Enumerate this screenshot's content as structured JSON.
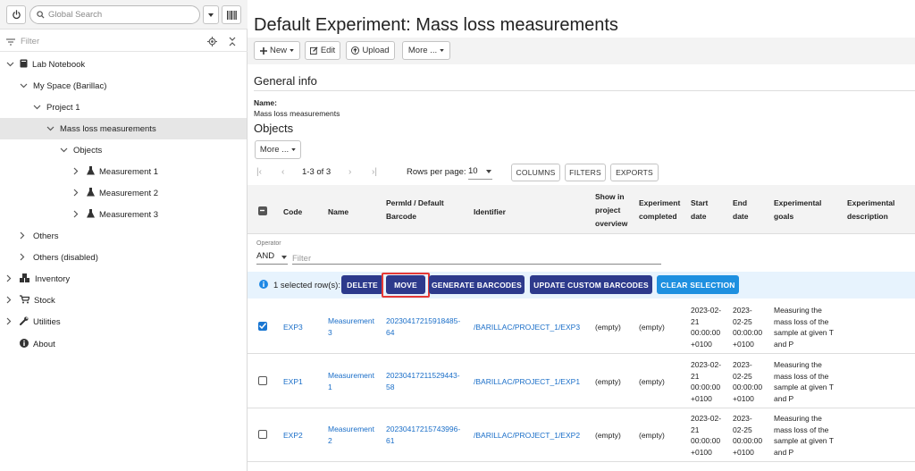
{
  "sidebar": {
    "search_placeholder": "Global Search",
    "filter_placeholder": "Filter",
    "tree": [
      {
        "label": "Lab Notebook",
        "icon": "book-icon",
        "chev": "down"
      },
      {
        "label": "My Space (Barillac)",
        "icon": "",
        "chev": "down"
      },
      {
        "label": "Project 1",
        "icon": "",
        "chev": "down"
      },
      {
        "label": "Mass loss measurements",
        "icon": "",
        "chev": "down"
      },
      {
        "label": "Objects",
        "icon": "",
        "chev": "down"
      },
      {
        "label": "Measurement 1",
        "icon": "flask-icon",
        "chev": "right"
      },
      {
        "label": "Measurement 2",
        "icon": "flask-icon",
        "chev": "right"
      },
      {
        "label": "Measurement 3",
        "icon": "flask-icon",
        "chev": "right"
      },
      {
        "label": "Others",
        "icon": "",
        "chev": "right"
      },
      {
        "label": "Others (disabled)",
        "icon": "",
        "chev": "right"
      },
      {
        "label": "Inventory",
        "icon": "boxes-icon",
        "chev": "right"
      },
      {
        "label": "Stock",
        "icon": "cart-icon",
        "chev": "right"
      },
      {
        "label": "Utilities",
        "icon": "wrench-icon",
        "chev": "right"
      },
      {
        "label": "About",
        "icon": "info-icon",
        "chev": ""
      }
    ]
  },
  "main": {
    "title": "Default Experiment: Mass loss measurements",
    "toolbar": {
      "new": "New",
      "edit": "Edit",
      "upload": "Upload",
      "more": "More ..."
    },
    "general_info": "General info",
    "name_label": "Name:",
    "name_value": "Mass loss measurements",
    "objects_heading": "Objects",
    "objects_more": "More ...",
    "pagination": {
      "range": "1-3 of 3",
      "rows_per_page_label": "Rows per page:",
      "rows_per_page": "10"
    },
    "table_buttons": {
      "columns": "COLUMNS",
      "filters": "FILTERS",
      "exports": "EXPORTS"
    },
    "headers": {
      "code": "Code",
      "name": "Name",
      "permid": [
        "PermId / Default",
        "Barcode"
      ],
      "identifier": "Identifier",
      "show_in_project": [
        "Show in",
        "project",
        "overview"
      ],
      "experiment_completed": [
        "Experiment",
        "completed"
      ],
      "start_date": [
        "Start",
        "date"
      ],
      "end_date": [
        "End",
        "date"
      ],
      "goals": [
        "Experimental",
        "goals"
      ],
      "description": [
        "Experimental",
        "description"
      ]
    },
    "filter": {
      "operator_label": "Operator",
      "operator": "AND",
      "placeholder": "Filter"
    },
    "selection": {
      "text": "1 selected row(s):",
      "delete": "DELETE",
      "move": "MOVE",
      "generate": "GENERATE BARCODES",
      "update": "UPDATE CUSTOM BARCODES",
      "clear": "CLEAR SELECTION"
    },
    "rows": [
      {
        "checked": true,
        "code": "EXP3",
        "name": [
          "Measurement",
          "3"
        ],
        "permid": [
          "20230417215918485-",
          "64"
        ],
        "identifier": "/BARILLAC/PROJECT_1/EXP3",
        "show": "(empty)",
        "completed": "(empty)",
        "start": [
          "2023-02-",
          "21",
          "00:00:00",
          "+0100"
        ],
        "end": [
          "2023-",
          "02-25",
          "00:00:00",
          "+0100"
        ],
        "goals": [
          "Measuring the",
          "mass loss of the",
          "sample at given T",
          "and P"
        ]
      },
      {
        "checked": false,
        "code": "EXP1",
        "name": [
          "Measurement",
          "1"
        ],
        "permid": [
          "20230417211529443-",
          "58"
        ],
        "identifier": "/BARILLAC/PROJECT_1/EXP1",
        "show": "(empty)",
        "completed": "(empty)",
        "start": [
          "2023-02-",
          "21",
          "00:00:00",
          "+0100"
        ],
        "end": [
          "2023-",
          "02-25",
          "00:00:00",
          "+0100"
        ],
        "goals": [
          "Measuring the",
          "mass loss of the",
          "sample at given T",
          "and P"
        ]
      },
      {
        "checked": false,
        "code": "EXP2",
        "name": [
          "Measurement",
          "2"
        ],
        "permid": [
          "20230417215743996-",
          "61"
        ],
        "identifier": "/BARILLAC/PROJECT_1/EXP2",
        "show": "(empty)",
        "completed": "(empty)",
        "start": [
          "2023-02-",
          "21",
          "00:00:00",
          "+0100"
        ],
        "end": [
          "2023-",
          "02-25",
          "00:00:00",
          "+0100"
        ],
        "goals": [
          "Measuring the",
          "mass loss of the",
          "sample at given T",
          "and P"
        ]
      }
    ]
  }
}
